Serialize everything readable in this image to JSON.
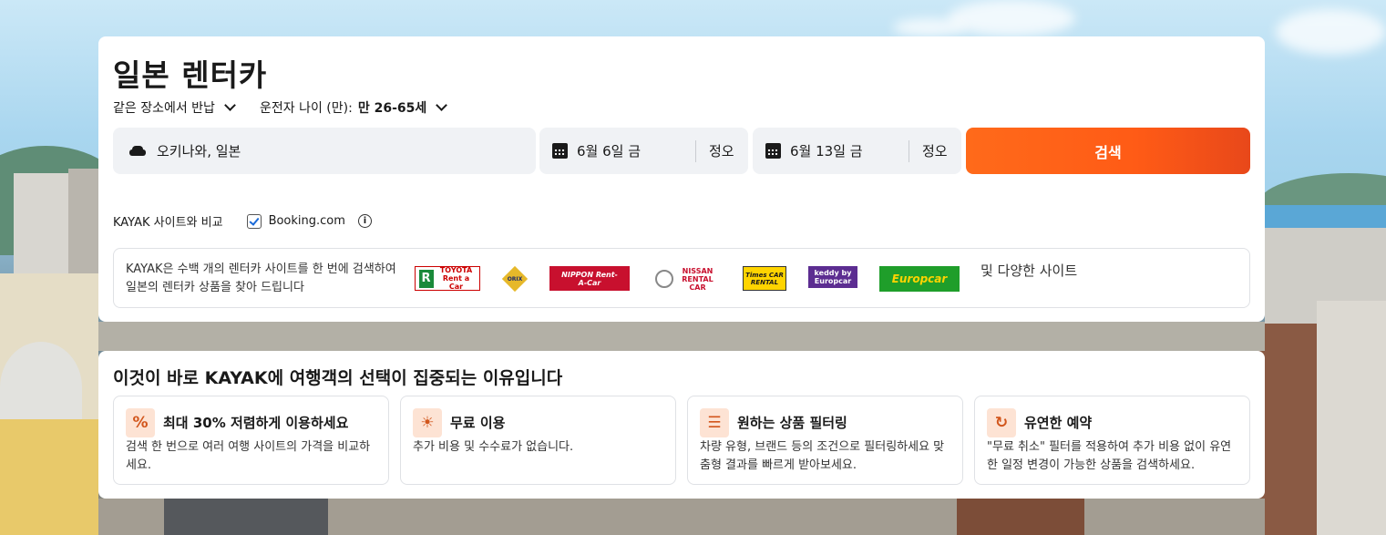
{
  "page": {
    "title": "일본 렌터카"
  },
  "options": {
    "return_label": "같은 장소에서 반납",
    "driver_age_prefix": "운전자 나이 (만):",
    "driver_age_value": "만 26-65세"
  },
  "search": {
    "location": "오키나와, 일본",
    "pickup_date": "6월 6일 금",
    "pickup_time": "정오",
    "dropoff_date": "6월 13일 금",
    "dropoff_time": "정오",
    "search_label": "검색"
  },
  "compare": {
    "label": "KAYAK 사이트와 비교",
    "site": "Booking.com",
    "site_checked": true,
    "info_icon": "info-icon"
  },
  "partners": {
    "text": "KAYAK은 수백 개의 렌터카 사이트를 한 번에 검색하여 일본의 렌터카 상품을 찾아 드립니다",
    "logos": [
      "TOYOTA Rent a Car",
      "ORIX",
      "NIPPON Rent-A-Car",
      "NISSAN RENTAL CAR",
      "Times CAR RENTAL",
      "keddy by Europcar",
      "Europcar"
    ],
    "more": "및 다양한 사이트"
  },
  "why": {
    "title": "이것이 바로 KAYAK에 여행객의 선택이 집중되는 이유입니다",
    "features": [
      {
        "icon": "discount-tag-icon",
        "title": "최대 30% 저렴하게 이용하세요",
        "desc": "검색 한 번으로 여러 여행 사이트의 가격을 비교하세요."
      },
      {
        "icon": "lightbulb-icon",
        "title": "무료 이용",
        "desc": "추가 비용 및 수수료가 없습니다."
      },
      {
        "icon": "filter-sliders-icon",
        "title": "원하는 상품 필터링",
        "desc": "차량 유형, 브랜드 등의 조건으로 필터링하세요 맞춤형 결과를 빠르게 받아보세요."
      },
      {
        "icon": "flexible-calendar-icon",
        "title": "유연한 예약",
        "desc": "\"무료 취소\" 필터를 적용하여 추가 비용 없이 유연한 일정 변경이 가능한 상품을 검색하세요."
      }
    ]
  },
  "colors": {
    "accent": "#ff6a1a",
    "field_bg": "#f0f2f5",
    "icon_bg": "#fde3d4"
  }
}
